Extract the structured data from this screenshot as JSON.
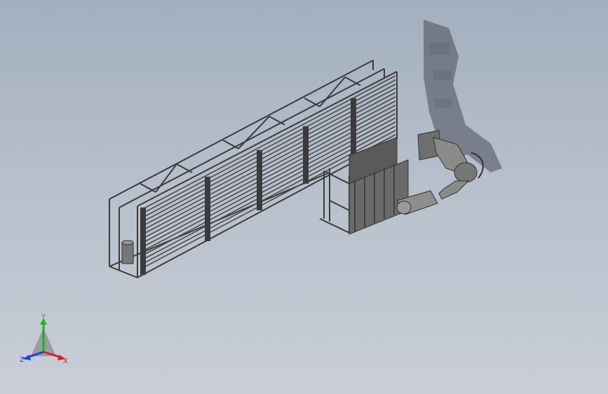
{
  "viewport": {
    "background_top": "#a3afbf",
    "background_bottom": "#c9ced7"
  },
  "model": {
    "frame_color": "#3b3b3b",
    "panel_color": "#5a5a5a",
    "arm_color": "#7e7e7e",
    "shadow_color": "#4a4e58"
  },
  "triad": {
    "x_label": "X",
    "y_label": "Y",
    "z_label": "Z",
    "x_color": "#e02020",
    "y_color": "#22b022",
    "z_color": "#2040e0"
  }
}
